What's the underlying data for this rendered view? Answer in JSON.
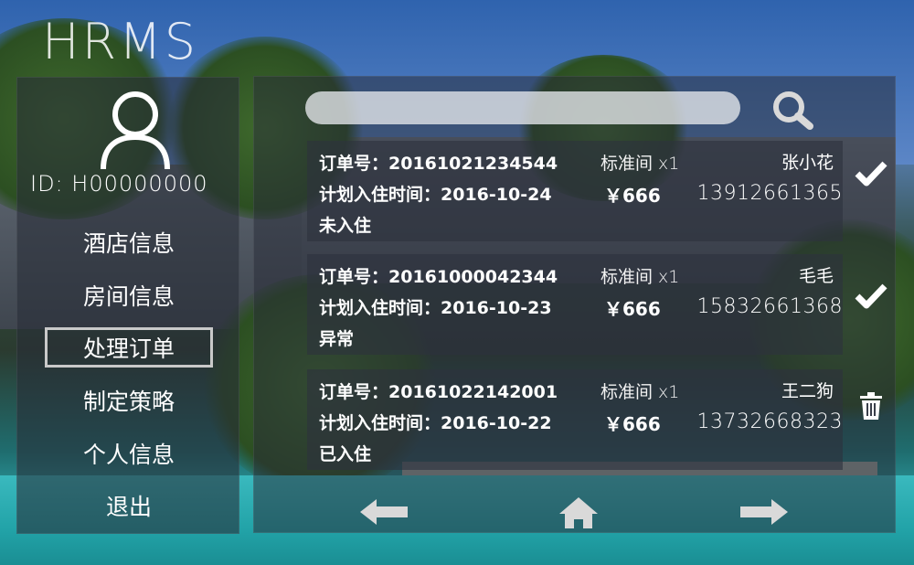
{
  "app": {
    "title": "HRMS"
  },
  "user": {
    "id_label": "ID:",
    "id_value": "H00000000"
  },
  "nav": {
    "items": [
      {
        "key": "hotel-info",
        "label": "酒店信息"
      },
      {
        "key": "room-info",
        "label": "房间信息"
      },
      {
        "key": "process-orders",
        "label": "处理订单",
        "active": true
      },
      {
        "key": "make-strategy",
        "label": "制定策略"
      },
      {
        "key": "personal-info",
        "label": "个人信息"
      },
      {
        "key": "logout",
        "label": "退出"
      }
    ]
  },
  "search": {
    "value": "",
    "placeholder": ""
  },
  "orders": [
    {
      "order_no": "订单号：20161021234544",
      "checkin": "计划入住时间：2016-10-24",
      "status": "未入住",
      "room": "标准间 x1",
      "price": "￥666",
      "guest": "张小花",
      "phone": "13912661365",
      "action": "check-icon"
    },
    {
      "order_no": "订单号：20161000042344",
      "checkin": "计划入住时间：2016-10-23",
      "status": "异常",
      "room": "标准间 x1",
      "price": "￥666",
      "guest": "毛毛",
      "phone": "15832661368",
      "action": "check-icon"
    },
    {
      "order_no": "订单号：20161022142001",
      "checkin": "计划入住时间：2016-10-22",
      "status": "已入住",
      "room": "标准间 x1",
      "price": "￥666",
      "guest": "王二狗",
      "phone": "13732668323",
      "action": "trash-icon"
    }
  ],
  "footer": {
    "prev": "arrow-left-icon",
    "home": "home-icon",
    "next": "arrow-right-icon"
  },
  "colors": {
    "panel": "#2d323e",
    "accent_border": "#c9c9c9",
    "icon_gray": "#d9d9d9"
  }
}
